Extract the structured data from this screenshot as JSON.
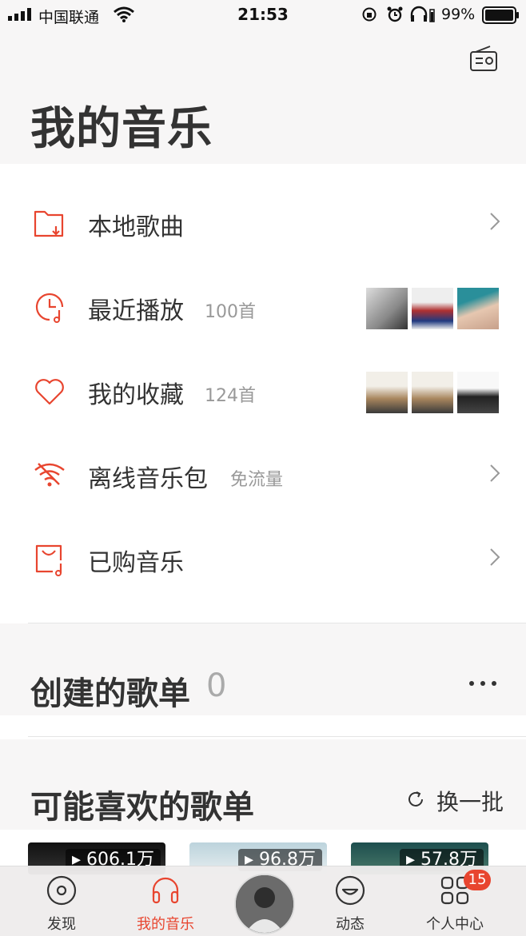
{
  "status_bar": {
    "carrier": "中国联通",
    "time": "21:53",
    "battery": "99%"
  },
  "header": {
    "title": "我的音乐",
    "radio_icon": "radio-icon"
  },
  "menu": [
    {
      "label": "本地歌曲",
      "sub": "",
      "icon": "folder-download-icon",
      "trailing": "chevron"
    },
    {
      "label": "最近播放",
      "sub": "100首",
      "icon": "clock-music-icon",
      "trailing": "thumbnails"
    },
    {
      "label": "我的收藏",
      "sub": "124首",
      "icon": "heart-icon",
      "trailing": "thumbnails"
    },
    {
      "label": "离线音乐包",
      "sub": "免流量",
      "icon": "wifi-offline-icon",
      "trailing": "chevron"
    },
    {
      "label": "已购音乐",
      "sub": "",
      "icon": "bag-music-icon",
      "trailing": "chevron"
    }
  ],
  "created_playlists": {
    "title": "创建的歌单",
    "count": "0"
  },
  "recommended": {
    "title": "可能喜欢的歌单",
    "refresh_label": "换一批",
    "cards": [
      {
        "plays": "606.1万"
      },
      {
        "plays": "96.8万"
      },
      {
        "plays": "57.8万"
      }
    ]
  },
  "tabs": [
    {
      "label": "发现",
      "icon": "disc-icon",
      "active": false
    },
    {
      "label": "我的音乐",
      "icon": "headphones-icon",
      "active": true
    },
    {
      "label": "动态",
      "icon": "smile-icon",
      "active": false
    },
    {
      "label": "个人中心",
      "icon": "grid-icon",
      "active": false,
      "badge": "15"
    }
  ],
  "colors": {
    "accent": "#e8452f",
    "text": "#333333",
    "muted": "#999999"
  }
}
